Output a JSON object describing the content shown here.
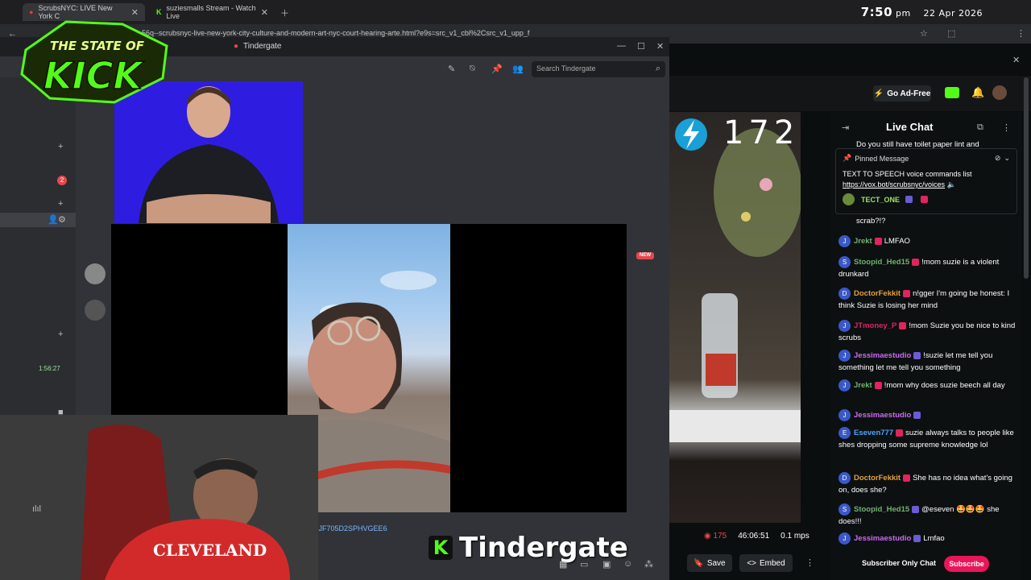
{
  "browser": {
    "tabs": [
      {
        "label": "ScrubsNYC: LIVE New York C"
      },
      {
        "label": "suziesmalls Stream - Watch Live"
      }
    ],
    "clock_time": "7:50",
    "clock_ampm": "pm",
    "clock_date": "22 Apr 2026",
    "url": "56q--scrubsnyc-live-new-york-city-culture-and-modern-art-nyc-court-hearing-arte.html?e9s=src_v1_cbl%2Csrc_v1_upp_f"
  },
  "overlay": {
    "logo_line1": "THE STATE OF",
    "logo_line2": "KICK",
    "title_k": "K",
    "title_text": "Tindergate"
  },
  "discord": {
    "window_title": "Tindergate",
    "search_placeholder": "Search Tindergate",
    "sidebar_badge": "2",
    "sidebar_timer": "1:56:27",
    "new_badge": "NEW",
    "hash_text": "01K31HAGRR6JF705D2SPHVGEE6"
  },
  "kick": {
    "ad_free_label": "Go Ad-Free",
    "viewer_overlay": "172",
    "viewers": "175",
    "uptime": "46:06:51",
    "bitrate": "0.1 mps",
    "save_label": "Save",
    "embed_label": "Embed"
  },
  "chat": {
    "title": "Live Chat",
    "overflow_top": "Do you still have toilet paper lint and",
    "pinned": {
      "label": "Pinned Message",
      "text": "TEXT TO SPEECH voice commands list ",
      "link": "https://vox.bot/scrubsnyc/voices",
      "author": "TECT_ONE"
    },
    "partial_line": "scrab?!?",
    "messages": [
      {
        "user": "Jrekt",
        "color": "#6fb26f",
        "text": "LMFAO"
      },
      {
        "user": "Stoopid_Hed15",
        "color": "#6fb26f",
        "text": "!mom suzie is a violent drunkard"
      },
      {
        "user": "DoctorFekkit",
        "color": "#e3a040",
        "text": "n!gger I'm going be honest: I think Suzie is losing her mind"
      },
      {
        "user": "JTmoney_P",
        "color": "#e0245e",
        "text": "!mom Suzie you be nice to kind scrubs"
      },
      {
        "user": "Jessimaestudio",
        "color": "#c86bf0",
        "text": "!suzie let me tell you something let me tell you something"
      },
      {
        "user": "Jrekt",
        "color": "#6fb26f",
        "text": "!mom why does suzie beech all day"
      },
      {
        "user": "Jessimaestudio",
        "color": "#c86bf0",
        "text": ""
      },
      {
        "user": "Eseven777",
        "color": "#4fa3ff",
        "text": "suzie always talks to people like shes dropping some supreme knowledge lol"
      },
      {
        "user": "DoctorFekkit",
        "color": "#e3a040",
        "text": "She has no idea what's going on, does she?"
      },
      {
        "user": "Stoopid_Hed15",
        "color": "#6fb26f",
        "text": "@eseven 🤩🤩🤩 she does!!!"
      },
      {
        "user": "Jessimaestudio",
        "color": "#c86bf0",
        "text": "Lmfao"
      }
    ],
    "subscriber_only": "Subscriber Only Chat",
    "subscribe_label": "Subscribe"
  },
  "colors": {
    "kick_green": "#53fc18",
    "subscribe": "#e9165a",
    "camera_bg": "#2e1de0"
  }
}
